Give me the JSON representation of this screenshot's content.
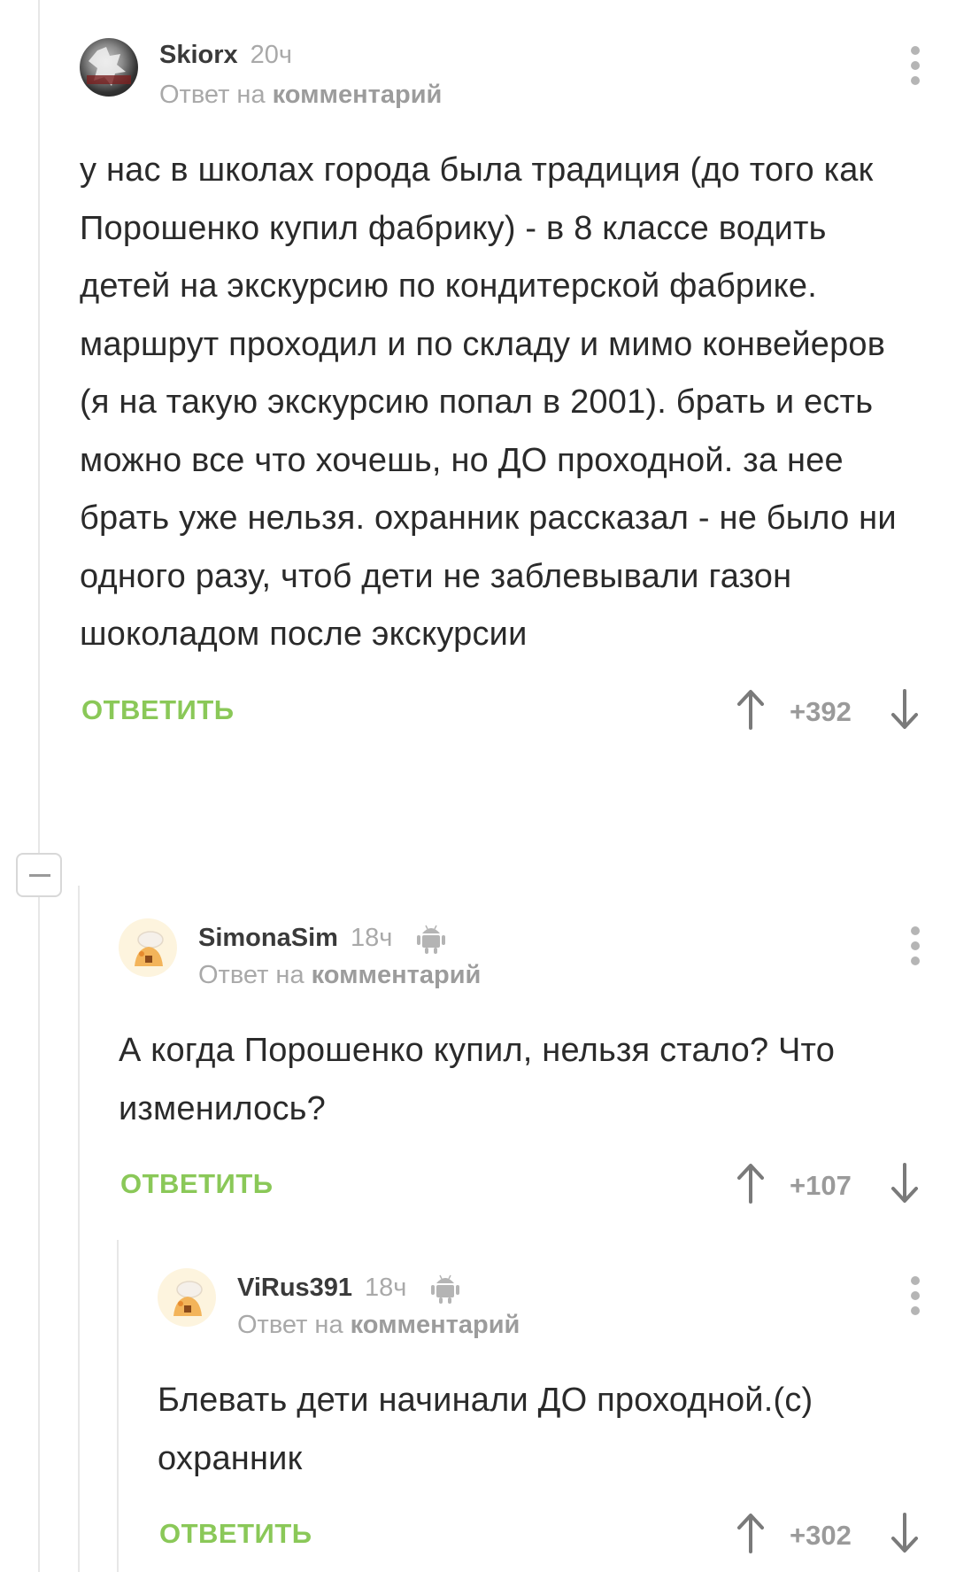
{
  "reply_prefix": "Ответ на",
  "reply_target": "комментарий",
  "reply_label": "ОТВЕТИТЬ",
  "icons": {
    "more": "more-vertical-icon",
    "vote_up": "arrow-up-icon",
    "vote_down": "arrow-down-icon",
    "platform": "android-icon",
    "collapse": "minus-icon"
  },
  "colors": {
    "accent_green": "#8ac858",
    "meta_grey": "#a9a9a9",
    "text": "#2a2a2a"
  },
  "comments": [
    {
      "author": "Skiorx",
      "time": "20ч",
      "text": "у нас в школах города была традиция (до того как Порошенко купил фабрику) - в 8 классе водить детей на экскурсию по кондитерской фабрике. маршрут проходил и по складу и мимо конвейеров (я на такую экскурсию попал в 2001). брать и есть можно все что хочешь, но ДО проходной. за нее брать уже нельзя. охранник рассказал - не было ни одного разу, чтоб дети не заблевывали газон шоколадом после экскурсии",
      "score": "+392"
    },
    {
      "author": "SimonaSim",
      "time": "18ч",
      "text": "А когда Порошенко купил, нельзя стало? Что изменилось?",
      "score": "+107"
    },
    {
      "author": "ViRus391",
      "time": "18ч",
      "text": "Блевать дети начинали ДО проходной.(с) охранник",
      "score": "+302"
    }
  ]
}
